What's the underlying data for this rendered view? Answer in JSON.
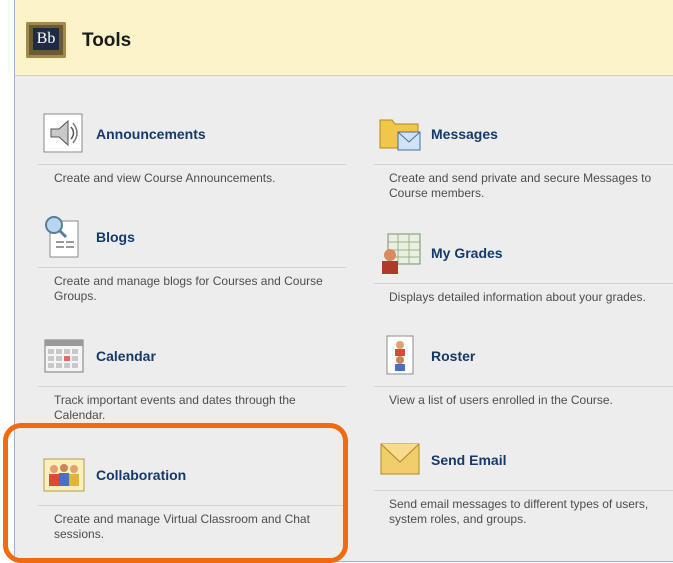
{
  "header": {
    "title": "Tools",
    "logo_text": "Bb"
  },
  "tools": {
    "announcements": {
      "label": "Announcements",
      "description": "Create and view Course Announcements.",
      "icon": "megaphone-icon"
    },
    "blogs": {
      "label": "Blogs",
      "description": "Create and manage blogs for Courses and Course Groups.",
      "icon": "blog-icon"
    },
    "calendar": {
      "label": "Calendar",
      "description": "Track important events and dates through the Calendar.",
      "icon": "calendar-icon"
    },
    "collaboration": {
      "label": "Collaboration",
      "description": "Create and manage Virtual Classroom and Chat sessions.",
      "icon": "people-icon"
    },
    "messages": {
      "label": "Messages",
      "description": "Create and send private and secure Messages to Course members.",
      "icon": "folder-envelope-icon"
    },
    "my_grades": {
      "label": "My Grades",
      "description": "Displays detailed information about your grades.",
      "icon": "grades-icon"
    },
    "roster": {
      "label": "Roster",
      "description": "View a list of users enrolled in the Course.",
      "icon": "roster-icon"
    },
    "send_email": {
      "label": "Send Email",
      "description": "Send email messages to different types of users, system roles, and groups.",
      "icon": "envelope-icon"
    }
  },
  "colors": {
    "header_bg": "#fcf3c8",
    "link": "#15396b",
    "highlight": "#f06a10",
    "panel_bg": "#ededed"
  }
}
